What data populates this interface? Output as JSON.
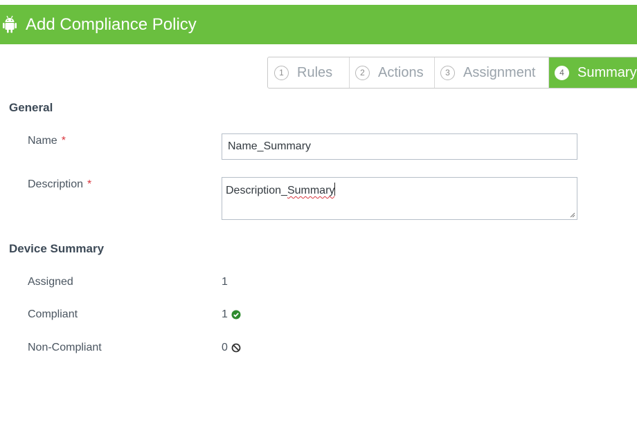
{
  "header": {
    "title": "Add Compliance Policy",
    "icon": "android-icon",
    "background": "#6abf3f"
  },
  "stepper": {
    "steps": [
      {
        "number": "1",
        "label": "Rules"
      },
      {
        "number": "2",
        "label": "Actions"
      },
      {
        "number": "3",
        "label": "Assignment"
      },
      {
        "number": "4",
        "label": "Summary"
      }
    ],
    "active_step": 4,
    "active_color": "#6abf3f"
  },
  "general": {
    "title": "General",
    "name_label": "Name",
    "description_label": "Description",
    "required_marker": "*",
    "name_value": "Name_Summary",
    "description_prefix": "Description_",
    "description_misspelled": "Summary"
  },
  "device_summary": {
    "title": "Device Summary",
    "rows": [
      {
        "label": "Assigned",
        "value": "1",
        "icon": ""
      },
      {
        "label": "Compliant",
        "value": "1",
        "icon": "check-circle-icon"
      },
      {
        "label": "Non-Compliant",
        "value": "0",
        "icon": "prohibited-icon"
      }
    ]
  },
  "colors": {
    "required": "#d9363e",
    "compliant": "#2e8b2e"
  }
}
